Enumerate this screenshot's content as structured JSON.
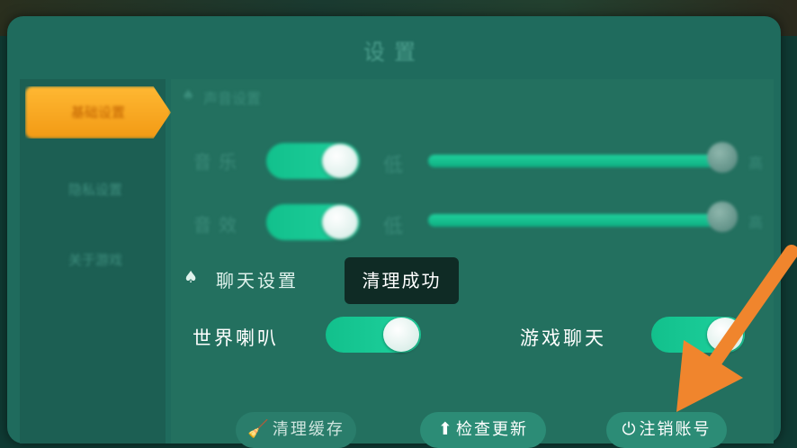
{
  "panel": {
    "title": "设置"
  },
  "sidebar": {
    "tabs": [
      {
        "label": "基础设置",
        "active": true
      },
      {
        "label": "隐私设置",
        "active": false
      },
      {
        "label": "关于游戏",
        "active": false
      }
    ]
  },
  "sound": {
    "section_label": "声音设置",
    "music": {
      "label": "音乐",
      "enabled": true,
      "low_label": "低",
      "high_label": "高",
      "level": 0.97
    },
    "effects": {
      "label": "音效",
      "enabled": true,
      "low_label": "低",
      "high_label": "高",
      "level": 0.97
    }
  },
  "chat": {
    "section_label": "聊天设置",
    "world_horn": {
      "label": "世界喇叭",
      "enabled": true
    },
    "game_chat": {
      "label": "游戏聊天",
      "enabled": true
    }
  },
  "toast": {
    "text": "清理成功"
  },
  "footer": {
    "clear_cache": {
      "label": "清理缓存",
      "icon": "broom-icon"
    },
    "check_update": {
      "label": "检查更新",
      "icon": "arrow-up-icon"
    },
    "logout": {
      "label": "注销账号",
      "icon": "power-icon"
    }
  },
  "colors": {
    "accent": "#1fd29e",
    "active_tab": "#f5a623",
    "annotation_arrow": "#f0852d"
  }
}
